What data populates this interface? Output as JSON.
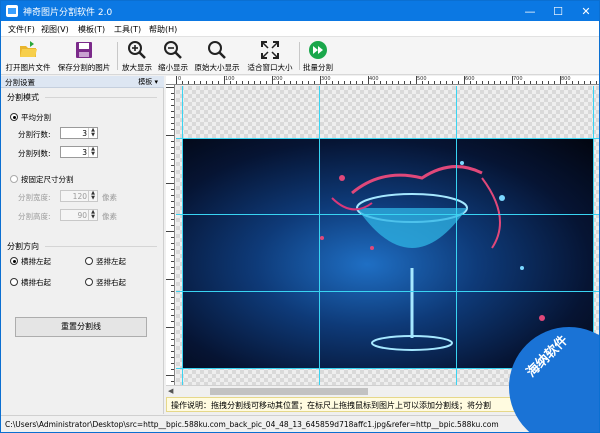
{
  "window": {
    "title": "神奇图片分割软件 2.0"
  },
  "window_controls": {
    "minimize": "—",
    "maximize": "☐",
    "close": "✕"
  },
  "menu": [
    "文件(F)",
    "视图(V)",
    "模板(T)",
    "工具(T)",
    "帮助(H)"
  ],
  "toolbar": [
    {
      "label": "打开图片文件",
      "icon": "open-folder-icon"
    },
    {
      "label": "保存分割的图片",
      "icon": "save-icon"
    },
    {
      "label": "放大显示",
      "icon": "zoom-in-icon"
    },
    {
      "label": "缩小显示",
      "icon": "zoom-out-icon"
    },
    {
      "label": "原始大小显示",
      "icon": "search-icon"
    },
    {
      "label": "适合窗口大小",
      "icon": "fit-window-icon"
    },
    {
      "label": "批量分割",
      "icon": "batch-split-icon"
    }
  ],
  "left_panel": {
    "header": "分割设置",
    "header_right": "模板 ▾",
    "split_mode_title": "分割模式",
    "even_split_label": "平均分割",
    "rows_label": "分割行数:",
    "rows_value": "3",
    "cols_label": "分割列数:",
    "cols_value": "3",
    "fixed_size_label": "按固定尺寸分割",
    "width_label": "分割宽度:",
    "width_value": "120",
    "height_label": "分割高度:",
    "height_value": "90",
    "unit": "像素",
    "direction_title": "分割方向",
    "directions": [
      "横排左起",
      "竖排左起",
      "横排右起",
      "竖排右起"
    ],
    "reset_button": "重置分割线"
  },
  "ruler_labels": [
    "0",
    "100",
    "200",
    "300",
    "400",
    "500",
    "600",
    "700",
    "800"
  ],
  "info_bar": "操作说明：拖拽分割线可移动其位置；在标尺上拖拽鼠标到图片上可以添加分割线；将分割",
  "status_bar": "C:\\Users\\Administrator\\Desktop\\src=http__bpic.588ku.com_back_pic_04_48_13_645859d718affc1.jpg&refer=http__bpic.588ku.com",
  "watermark": "海纳软件",
  "colors": {
    "title_bar": "#0b78e3",
    "split_line": "#39d4f2",
    "photo_bg": "#0e3a78"
  }
}
